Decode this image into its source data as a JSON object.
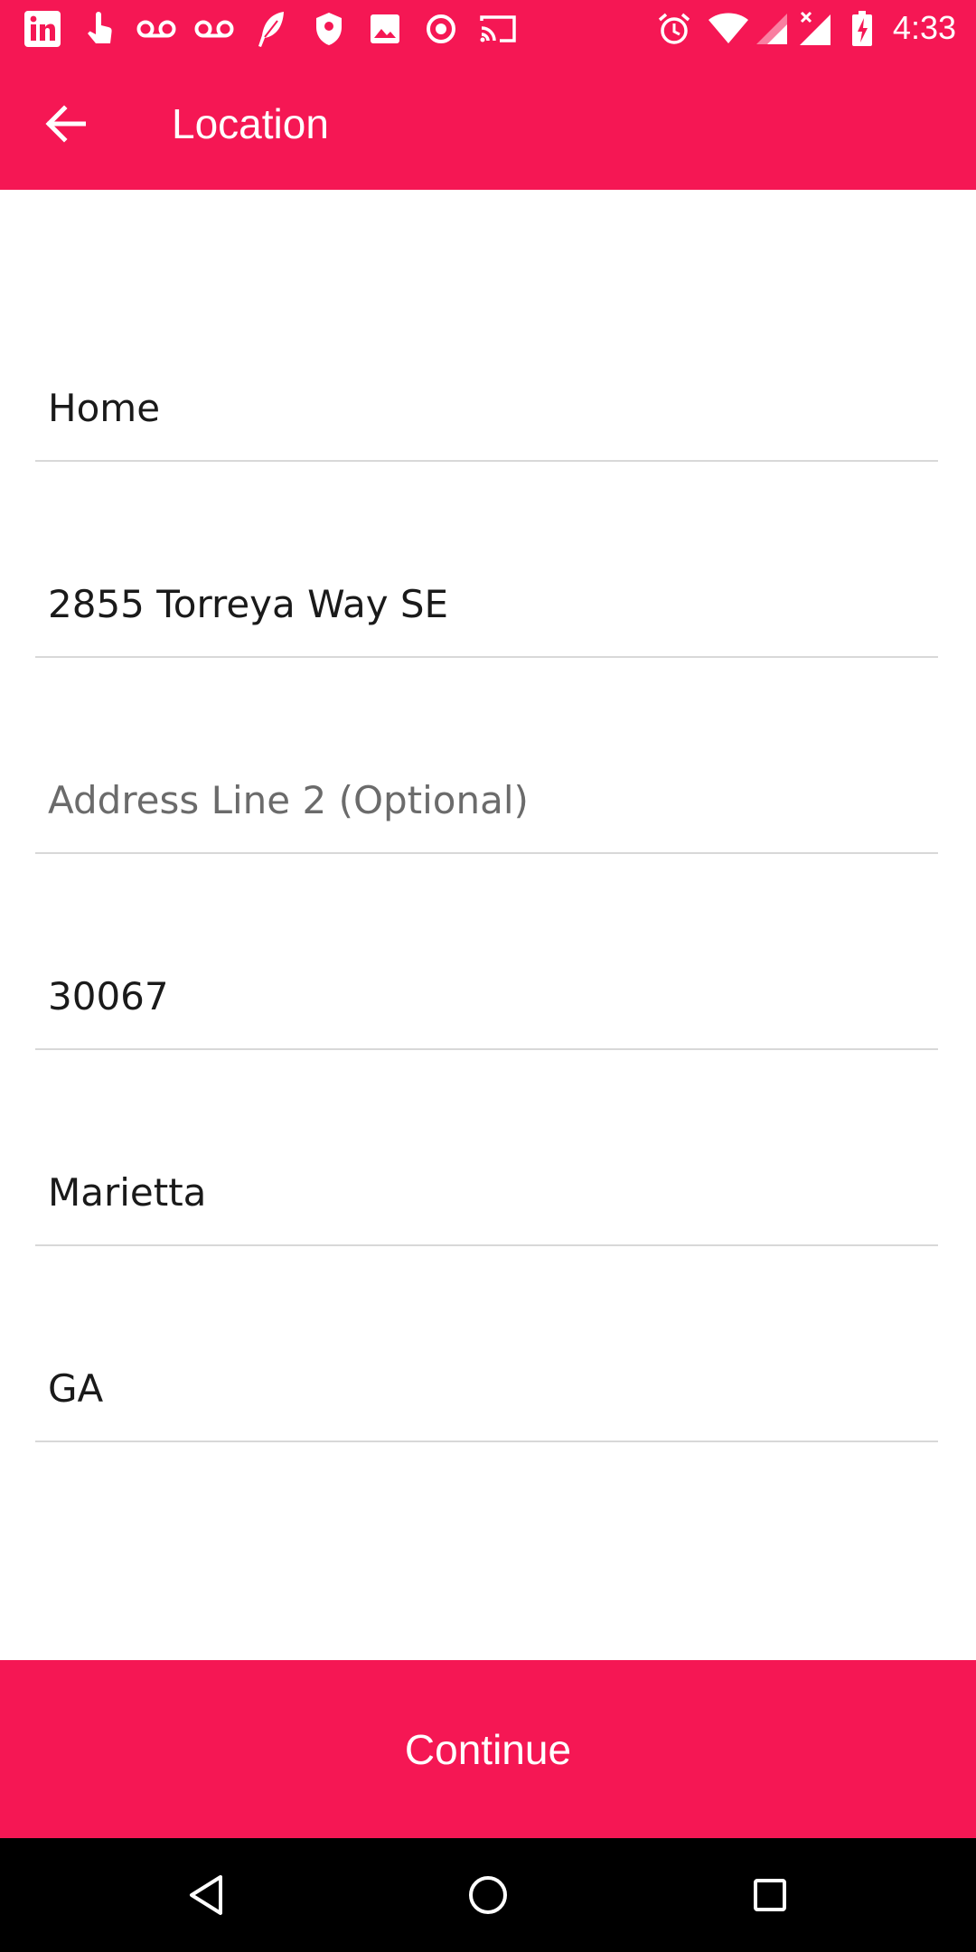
{
  "status_bar": {
    "time": "4:33",
    "left_icons": [
      "linkedin-icon",
      "touch-icon",
      "voicemail-icon",
      "voicemail-icon",
      "feather-icon",
      "shield-icon",
      "image-icon",
      "record-icon",
      "cast-icon"
    ],
    "right_icons": [
      "alarm-icon",
      "wifi-icon",
      "signal-icon",
      "signal-no-data-icon",
      "battery-charging-icon"
    ]
  },
  "app_bar": {
    "title": "Location",
    "back_icon": "arrow-back-icon"
  },
  "form": {
    "fields": [
      {
        "name": "label",
        "value": "Home",
        "placeholder": ""
      },
      {
        "name": "address-line-1",
        "value": "2855 Torreya Way SE",
        "placeholder": ""
      },
      {
        "name": "address-line-2",
        "value": "",
        "placeholder": "Address Line 2 (Optional)"
      },
      {
        "name": "zip",
        "value": "30067",
        "placeholder": ""
      },
      {
        "name": "city",
        "value": "Marietta",
        "placeholder": ""
      },
      {
        "name": "state",
        "value": "GA",
        "placeholder": ""
      }
    ]
  },
  "continue_label": "Continue",
  "nav_bar": {
    "icons": [
      "nav-back-icon",
      "nav-home-icon",
      "nav-recents-icon"
    ]
  },
  "colors": {
    "accent": "#f51754",
    "divider": "#d8d8d8",
    "text": "#1a1a1a",
    "placeholder": "#6b6b6b"
  }
}
